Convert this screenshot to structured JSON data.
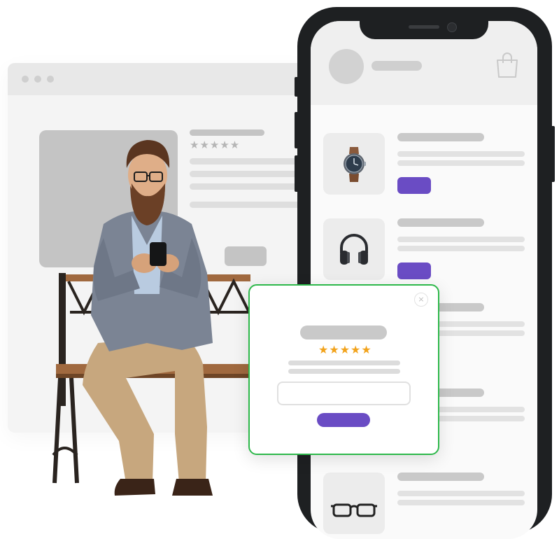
{
  "browser_mock": {
    "rating_stars": "★★★★★"
  },
  "phone": {
    "products": [
      {
        "icon": "smartwatch-icon"
      },
      {
        "icon": "headphones-icon"
      },
      {
        "icon": "placeholder"
      },
      {
        "icon": "placeholder"
      },
      {
        "icon": "eyeglasses-icon"
      }
    ],
    "accent": "#6a4cc4"
  },
  "review_popup": {
    "stars": "★★★★★",
    "close_symbol": "×",
    "border_color": "#2db84a",
    "star_color": "#f2a31c"
  }
}
